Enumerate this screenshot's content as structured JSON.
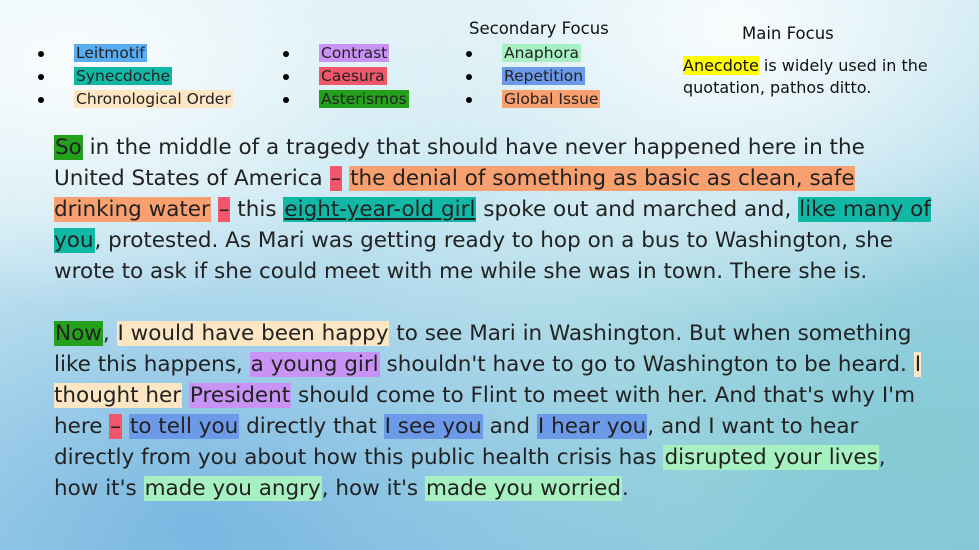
{
  "colors": {
    "Leitmotif": "#5aacf0",
    "Synecdoche": "#12b8a6",
    "Chronological Order": "#fce6c4",
    "Contrast": "#c993f5",
    "Caesura": "#f2566b",
    "Asterismos": "#23a11d",
    "Anaphora": "#a6f0c2",
    "Repetition": "#6c9ae8",
    "Global Issue": "#f8a070",
    "Anecdote": "#ffff00"
  },
  "legend": {
    "col1": [
      "Leitmotif",
      "Synecdoche",
      "Chronological Order"
    ],
    "col2": [
      "Contrast",
      "Caesura",
      "Asterismos"
    ],
    "col3": [
      "Anaphora",
      "Repetition",
      "Global Issue"
    ]
  },
  "secondary_heading": "Secondary Focus",
  "main_heading": "Main Focus",
  "main_note": {
    "highlight": "Anecdote",
    "rest": " is widely used in the quotation, pathos ditto."
  },
  "paragraphs": [
    [
      {
        "t": "So",
        "c": "Asterismos"
      },
      {
        "t": " in the middle of a tragedy that should have never happened here in the United States of America "
      },
      {
        "t": "–",
        "c": "Caesura"
      },
      {
        "t": " "
      },
      {
        "t": "the denial of something as basic as clean, safe drinking water",
        "c": "Global Issue"
      },
      {
        "t": " "
      },
      {
        "t": "–",
        "c": "Caesura"
      },
      {
        "t": " this "
      },
      {
        "t": "eight-year-old girl",
        "c": "Synecdoche",
        "u": true
      },
      {
        "t": " spoke out and marched and, "
      },
      {
        "t": "like many of you",
        "c": "Synecdoche"
      },
      {
        "t": ", protested. As Mari was getting ready to hop on a bus to Washington, she wrote to ask if she could meet with me while she was in town. There she is."
      }
    ],
    [
      {
        "t": "Now",
        "c": "Asterismos"
      },
      {
        "t": ", "
      },
      {
        "t": "I would have been happy",
        "c": "Chronological Order"
      },
      {
        "t": " to see Mari in Washington. But when something like this happens, "
      },
      {
        "t": "a young girl",
        "c": "Contrast"
      },
      {
        "t": " shouldn't have to go to Washington to be heard. "
      },
      {
        "t": "I thought her",
        "c": "Chronological Order"
      },
      {
        "t": " "
      },
      {
        "t": "President",
        "c": "Contrast"
      },
      {
        "t": " should come to Flint to meet with her. And that's why I'm here "
      },
      {
        "t": "–",
        "c": "Caesura"
      },
      {
        "t": " "
      },
      {
        "t": "to tell you",
        "c": "Repetition"
      },
      {
        "t": " directly that "
      },
      {
        "t": "I see you",
        "c": "Repetition"
      },
      {
        "t": " and "
      },
      {
        "t": "I hear you",
        "c": "Repetition"
      },
      {
        "t": ", and I want to hear directly from you about how this public health crisis has "
      },
      {
        "t": "disrupted your lives",
        "c": "Anaphora"
      },
      {
        "t": ", how it's "
      },
      {
        "t": "made you angry",
        "c": "Anaphora"
      },
      {
        "t": ", how it's "
      },
      {
        "t": "made you worried",
        "c": "Anaphora"
      },
      {
        "t": "."
      }
    ]
  ]
}
